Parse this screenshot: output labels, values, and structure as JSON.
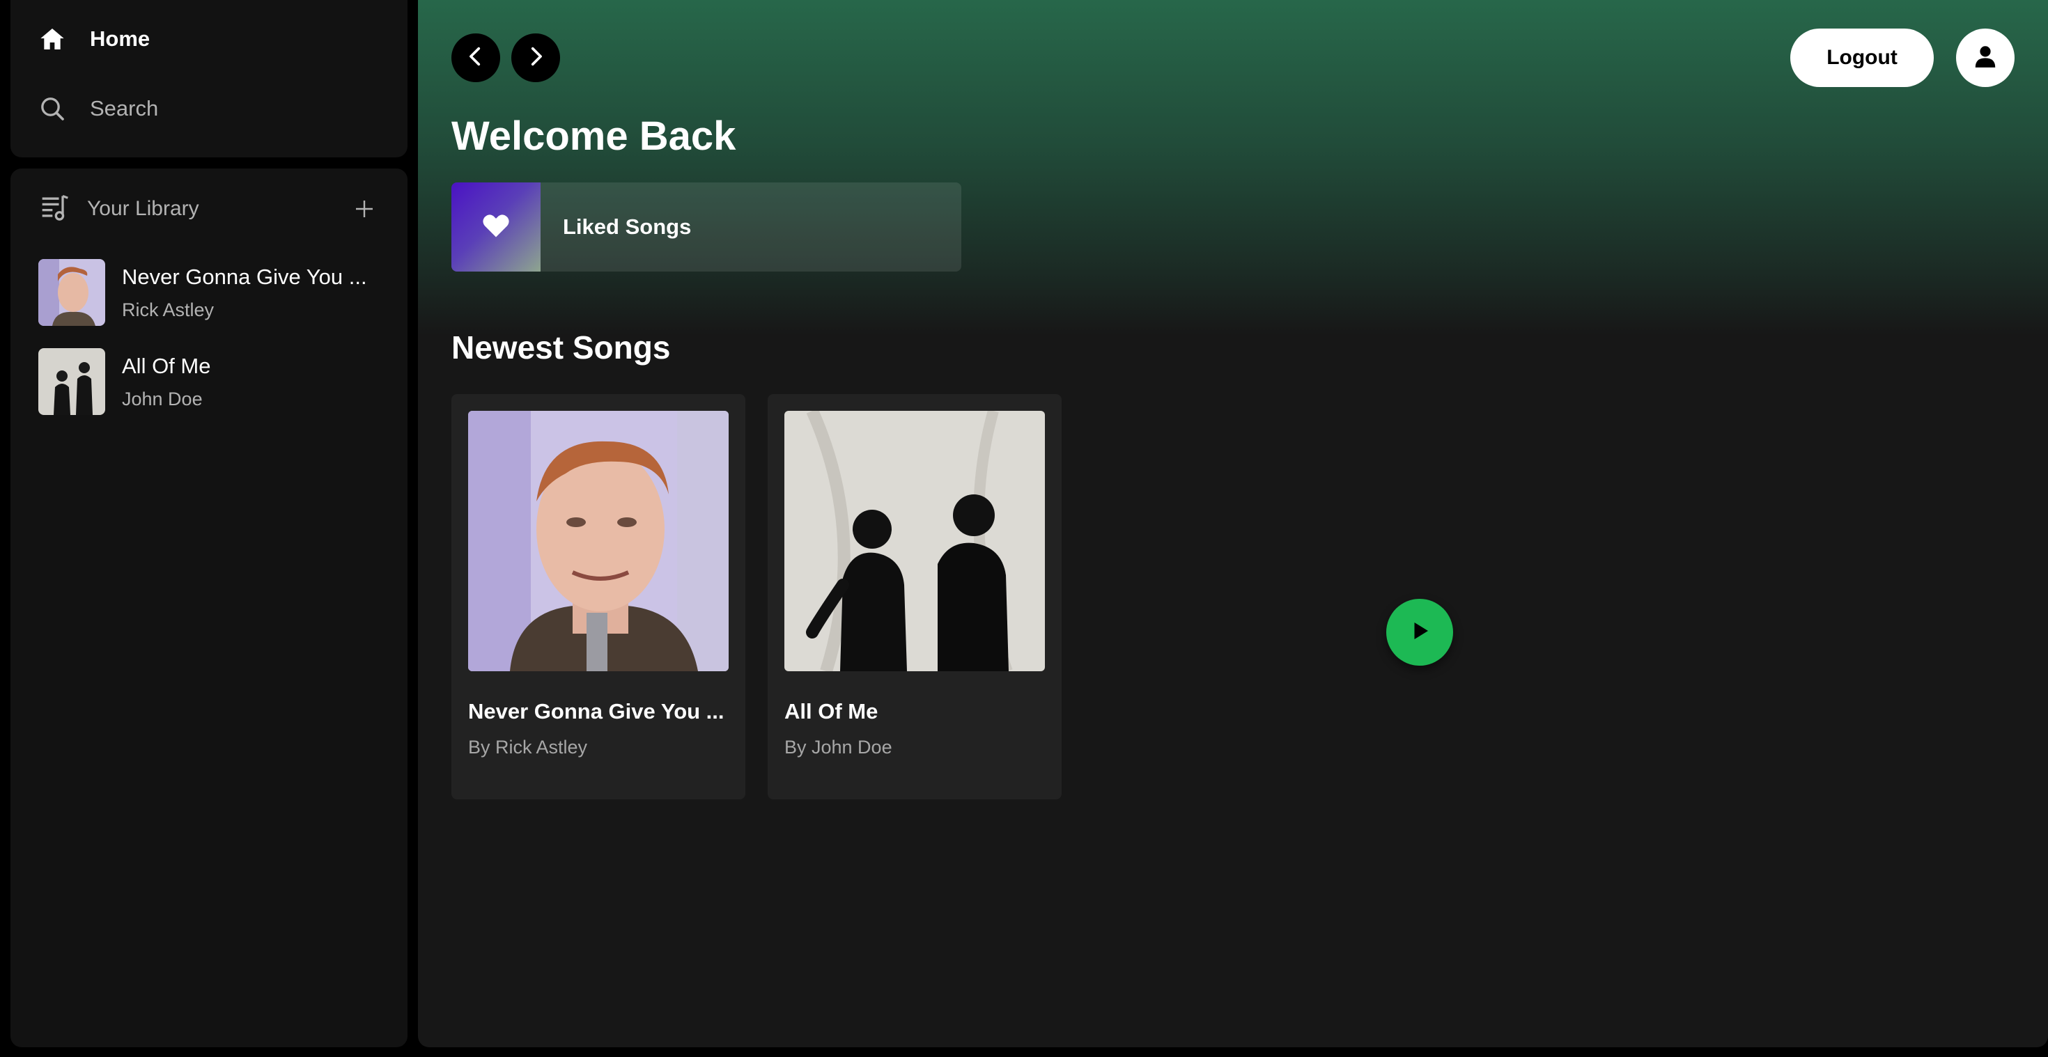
{
  "sidebar": {
    "nav": {
      "home_label": "Home",
      "search_label": "Search"
    },
    "library": {
      "title": "Your Library",
      "items": [
        {
          "song": "Never Gonna Give You ...",
          "artist": "Rick Astley"
        },
        {
          "song": "All Of Me",
          "artist": "John Doe"
        }
      ]
    }
  },
  "header": {
    "logout_label": "Logout"
  },
  "main": {
    "welcome": "Welcome Back",
    "liked_songs_label": "Liked Songs",
    "newest_title": "Newest Songs",
    "songs": [
      {
        "title": "Never Gonna Give You ...",
        "artist": "By Rick Astley"
      },
      {
        "title": "All Of Me",
        "artist": "By John Doe"
      }
    ]
  },
  "colors": {
    "accent": "#1db954",
    "background": "#121212",
    "header_gradient_top": "#27674a"
  },
  "icons": [
    "home-icon",
    "search-icon",
    "library-icon",
    "plus-icon",
    "chevron-left-icon",
    "chevron-right-icon",
    "user-icon",
    "heart-icon",
    "play-icon"
  ]
}
